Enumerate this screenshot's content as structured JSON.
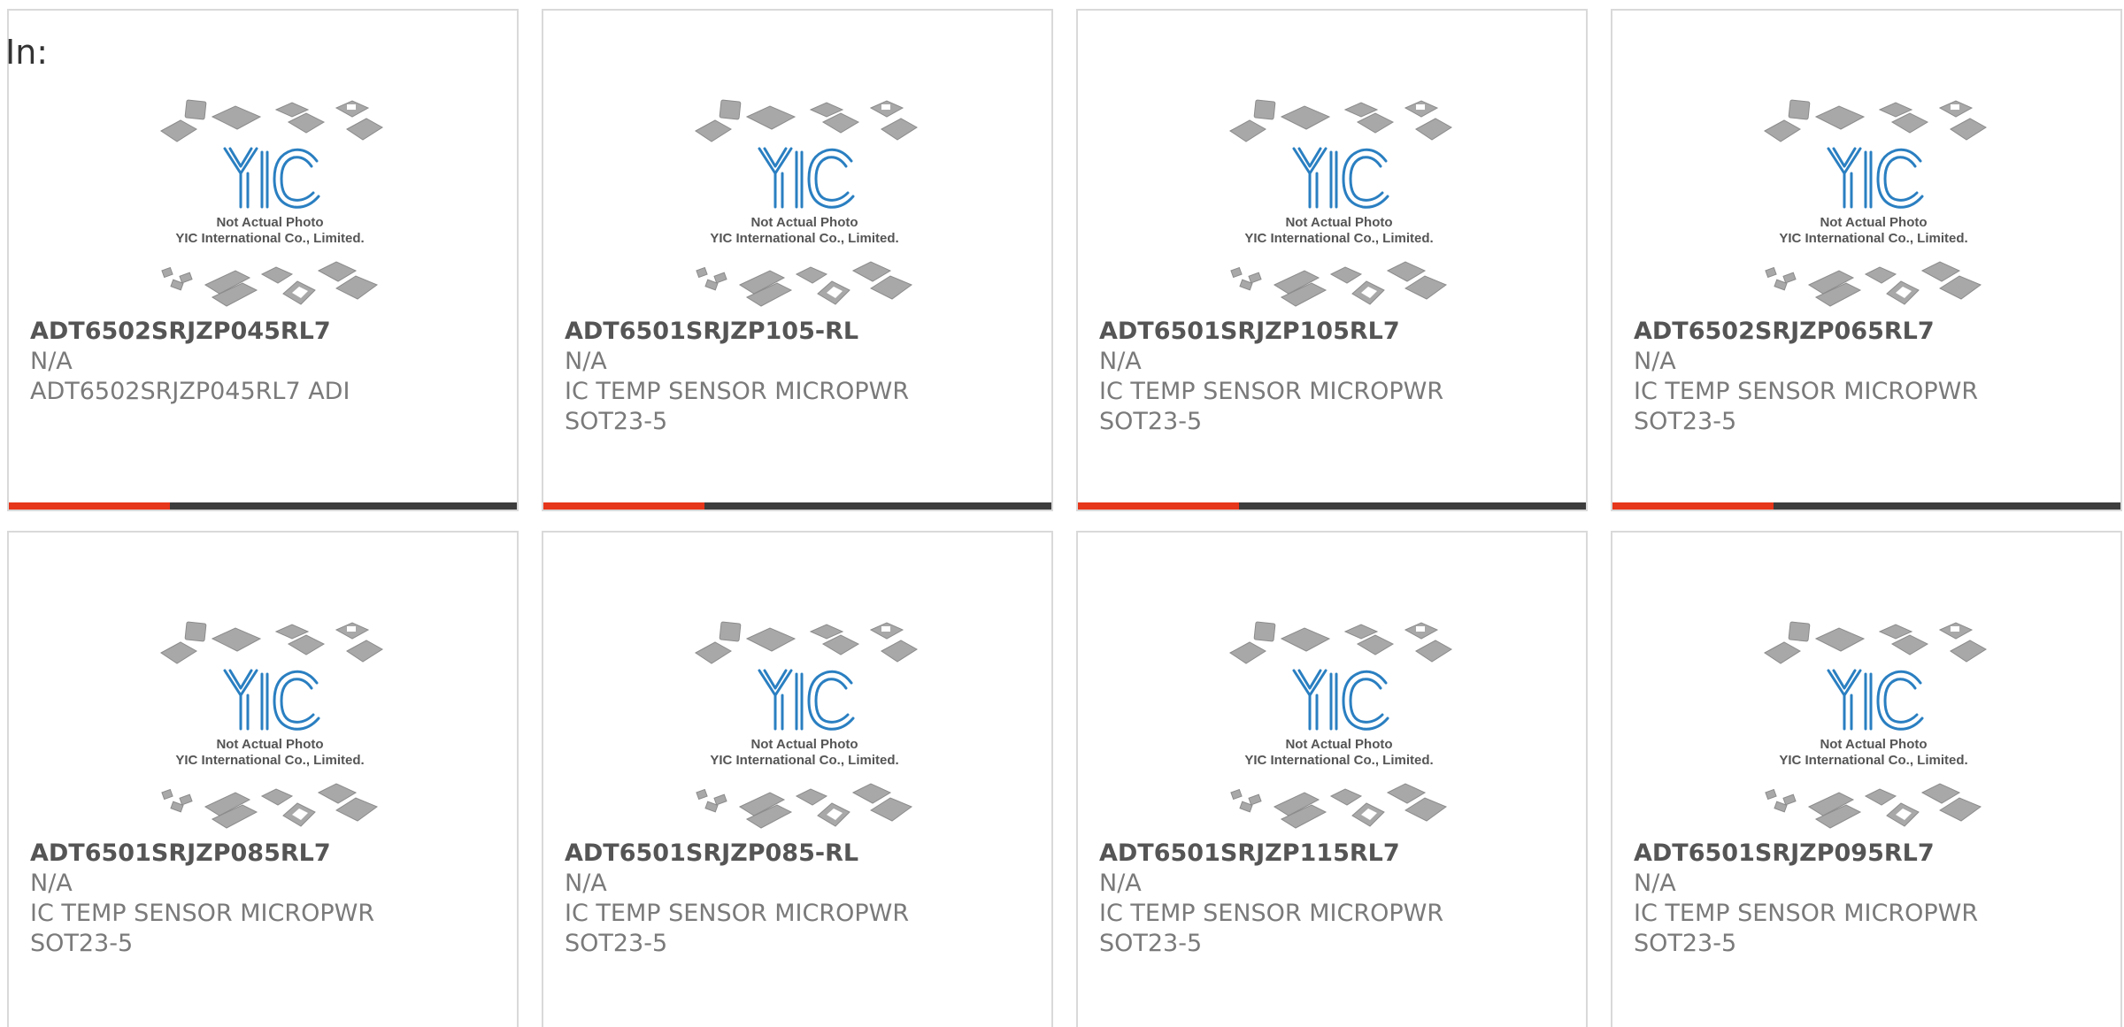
{
  "filter_label": "In:",
  "colors": {
    "accent": "#e6361b",
    "bar": "#3d3d3d",
    "logo_blue": "#2a7fc1"
  },
  "thumbnail": {
    "icon": "yic-chip-package-placeholder",
    "caption_line1": "Not Actual Photo",
    "caption_line2": "YIC International Co., Limited.",
    "logo_text": "YIC"
  },
  "products": [
    {
      "part": "ADT6502SRJZP045RL7",
      "mfr": "N/A",
      "desc1": "ADT6502SRJZP045RL7 ADI",
      "desc2": ""
    },
    {
      "part": "ADT6501SRJZP105-RL",
      "mfr": "N/A",
      "desc1": "IC TEMP SENSOR MICROPWR",
      "desc2": "SOT23-5"
    },
    {
      "part": "ADT6501SRJZP105RL7",
      "mfr": "N/A",
      "desc1": "IC TEMP SENSOR MICROPWR",
      "desc2": "SOT23-5"
    },
    {
      "part": "ADT6502SRJZP065RL7",
      "mfr": "N/A",
      "desc1": "IC TEMP SENSOR MICROPWR",
      "desc2": "SOT23-5"
    },
    {
      "part": "ADT6501SRJZP085RL7",
      "mfr": "N/A",
      "desc1": "IC TEMP SENSOR MICROPWR",
      "desc2": "SOT23-5"
    },
    {
      "part": "ADT6501SRJZP085-RL",
      "mfr": "N/A",
      "desc1": "IC TEMP SENSOR MICROPWR",
      "desc2": "SOT23-5"
    },
    {
      "part": "ADT6501SRJZP115RL7",
      "mfr": "N/A",
      "desc1": "IC TEMP SENSOR MICROPWR",
      "desc2": "SOT23-5"
    },
    {
      "part": "ADT6501SRJZP095RL7",
      "mfr": "N/A",
      "desc1": "IC TEMP SENSOR MICROPWR",
      "desc2": "SOT23-5"
    }
  ]
}
